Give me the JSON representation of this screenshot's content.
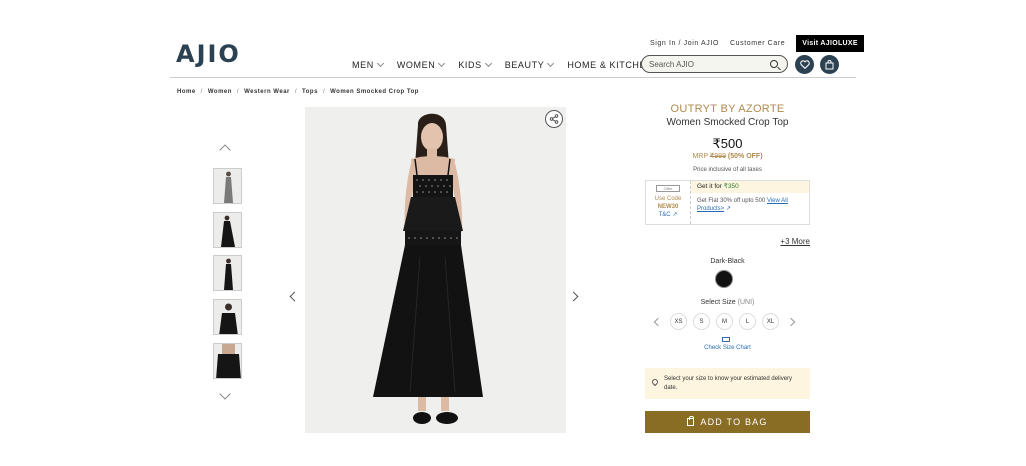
{
  "header": {
    "logo": "AJIO",
    "sign_in": "Sign In / Join AJIO",
    "customer_care": "Customer Care",
    "visit_luxe": "Visit AJIOLUXE",
    "nav": [
      "MEN",
      "WOMEN",
      "KIDS",
      "BEAUTY",
      "HOME & KITCHEN"
    ],
    "search_placeholder": "Search AJIO"
  },
  "breadcrumb": [
    "Home",
    "Women",
    "Western Wear",
    "Tops",
    "Women Smocked Crop Top"
  ],
  "product": {
    "brand": "OUTRYT BY AZORTE",
    "name": "Women Smocked Crop Top",
    "price": "₹500",
    "mrp_label": "MRP",
    "mrp": "₹999",
    "discount": "(50% OFF)",
    "tax_note": "Price inclusive of all taxes"
  },
  "offer": {
    "tag": "Offer",
    "use_code": "Use Code",
    "code": "NEW30",
    "tc": "T&C",
    "get_it_for": "Get it for",
    "offer_price": "₹350",
    "detail": "Get Flat 30% off upto 500",
    "view_all": "View All Products>"
  },
  "more_offers": "+3 More",
  "color": {
    "name": "Dark-Black",
    "swatch": "#111111"
  },
  "size": {
    "title": "Select Size",
    "unit": "(UNI)",
    "options": [
      "XS",
      "S",
      "M",
      "L",
      "XL"
    ],
    "chart_link": "Check Size Chart"
  },
  "delivery_note": "Select your size to know your estimated delivery date.",
  "add_to_bag": "ADD TO BAG",
  "colors": {
    "brand_gold": "#8a6d25",
    "logo_blue": "#2c4152"
  }
}
